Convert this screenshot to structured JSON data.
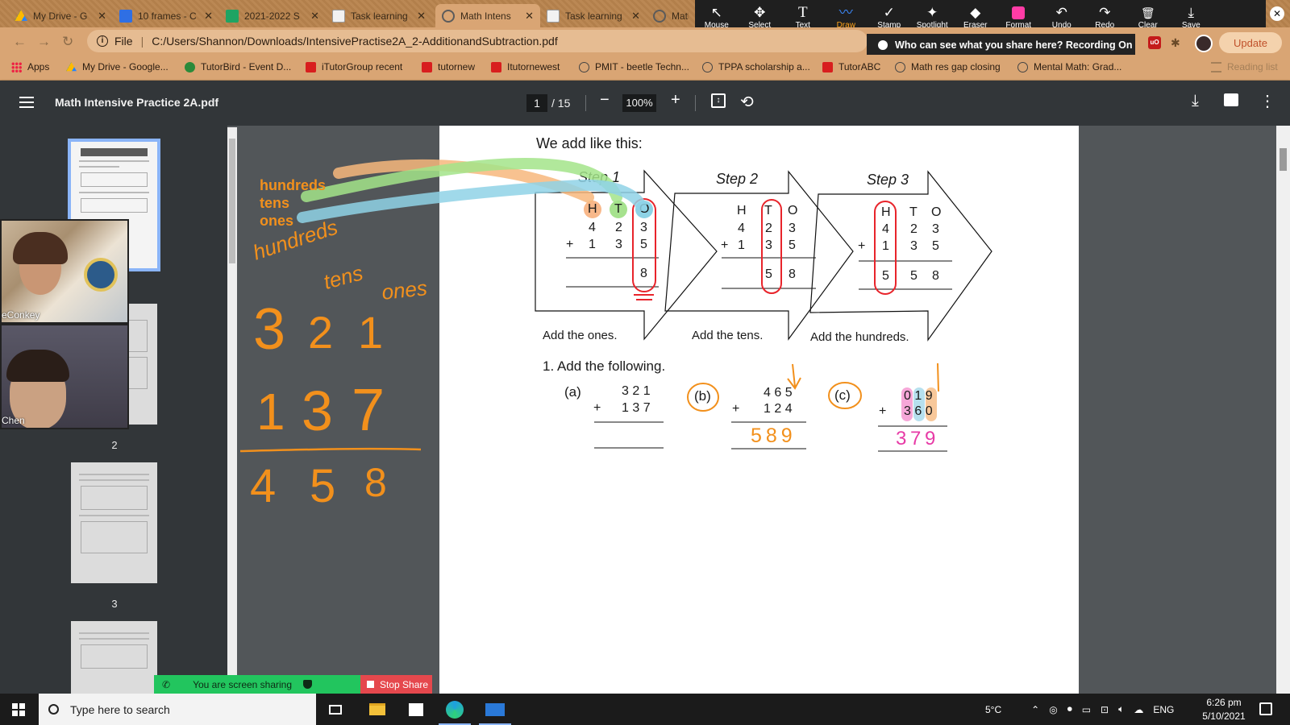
{
  "tabs": [
    {
      "label": "My Drive - G",
      "icon": "google-drive-icon",
      "close": "✕"
    },
    {
      "label": "10 frames - C",
      "icon": "google-docs-icon",
      "close": "✕"
    },
    {
      "label": "2021-2022 S",
      "icon": "google-sheets-icon",
      "close": "✕"
    },
    {
      "label": "Task learning",
      "icon": "page-icon",
      "close": "✕"
    },
    {
      "label": "Math Intens",
      "icon": "globe-icon",
      "close": "✕"
    },
    {
      "label": "Task learning",
      "icon": "page-icon",
      "close": "✕"
    },
    {
      "label": "MathT",
      "icon": "globe-icon"
    }
  ],
  "annotation_toolbar": {
    "tools": [
      {
        "label": "Mouse",
        "icon": "↖"
      },
      {
        "label": "Select",
        "icon": "✥"
      },
      {
        "label": "Text",
        "icon": "T"
      },
      {
        "label": "Draw",
        "icon": "〰"
      },
      {
        "label": "Stamp",
        "icon": "✓"
      },
      {
        "label": "Spotlight",
        "icon": "✦"
      },
      {
        "label": "Eraser",
        "icon": "◆"
      },
      {
        "label": "Format",
        "icon": ""
      },
      {
        "label": "Undo",
        "icon": "↶"
      },
      {
        "label": "Redo",
        "icon": "↷"
      },
      {
        "label": "Clear",
        "icon": "🗑"
      },
      {
        "label": "Save",
        "icon": "⤓"
      }
    ],
    "selected": "Draw",
    "format_color": "#ff3ca6",
    "close_glyph": "✕"
  },
  "address": {
    "scheme": "File",
    "url": "C:/Users/Shannon/Downloads/IntensivePractise2A_2-AdditionandSubtraction.pdf"
  },
  "share_notice": "Who can see what you share here? Recording On",
  "update_button": "Update",
  "extension_badge": "uO",
  "bookmarks": [
    {
      "label": "Apps",
      "icon": "apps-grid-icon"
    },
    {
      "label": "My Drive - Google...",
      "icon": "google-drive-icon"
    },
    {
      "label": "TutorBird - Event D...",
      "icon": "tutorbird-icon"
    },
    {
      "label": "iTutorGroup recent",
      "icon": "itutor-icon"
    },
    {
      "label": "tutornew",
      "icon": "itutor-icon"
    },
    {
      "label": "Itutornewest",
      "icon": "itutor-icon"
    },
    {
      "label": "PMIT - beetle Techn...",
      "icon": "globe-icon"
    },
    {
      "label": "TPPA scholarship a...",
      "icon": "globe-icon"
    },
    {
      "label": "TutorABC",
      "icon": "itutor-icon"
    },
    {
      "label": "Math res gap closing",
      "icon": "globe-icon"
    },
    {
      "label": "Mental Math: Grad...",
      "icon": "globe-icon"
    },
    {
      "label": "Reading list",
      "icon": "reading-list-icon"
    }
  ],
  "pdf": {
    "title": "Math Intensive Practice 2A.pdf",
    "page": "1",
    "page_total": "/ 15",
    "zoom": "100%",
    "thumb_numbers": [
      "2",
      "3"
    ]
  },
  "document": {
    "intro": "We add like this:",
    "steps": [
      {
        "title": "Step 1",
        "caption": "Add the ones."
      },
      {
        "title": "Step 2",
        "caption": "Add the tens."
      },
      {
        "title": "Step 3",
        "caption": "Add the hundreds."
      }
    ],
    "headers": [
      "H",
      "T",
      "O"
    ],
    "plus": "+",
    "addend1": [
      "4",
      "2",
      "3"
    ],
    "addend2": [
      "1",
      "3",
      "5"
    ],
    "step_results": [
      [
        "",
        "",
        "8"
      ],
      [
        "",
        "5",
        "8"
      ],
      [
        "5",
        "5",
        "8"
      ]
    ],
    "question": "1.  Add the following.",
    "problems": [
      {
        "label": "(a)",
        "top": "3 2 1",
        "bottom": "1 3 7",
        "answer": ""
      },
      {
        "label": "(b)",
        "top": "4 6 5",
        "bottom": "1 2 4",
        "answer": "5 8 9"
      },
      {
        "label": "(c)",
        "top": "0 1 9",
        "bottom": "3 6 0",
        "answer": "3 7 9"
      }
    ]
  },
  "ink": {
    "labels": [
      "hundreds",
      "tens",
      "ones"
    ],
    "handwriting": [
      "hundreds",
      "tens",
      "ones"
    ],
    "sum_top": [
      "3",
      "2",
      "1"
    ],
    "sum_bottom": [
      "1",
      "3",
      "7"
    ],
    "sum_result": [
      "4",
      "5",
      "8"
    ],
    "ink_color": "#f2901c",
    "highlight_colors": {
      "hundreds": "#f8b88a",
      "tens": "#a6e28e",
      "ones": "#8ed3e6"
    }
  },
  "participants": [
    {
      "name": "eConkey"
    },
    {
      "name": "Chen"
    }
  ],
  "screen_share": {
    "status": "You are screen sharing",
    "stop": "Stop Share"
  },
  "taskbar": {
    "search_placeholder": "Type here to search",
    "temperature": "5°C",
    "language": "ENG",
    "time": "6:26 pm",
    "date": "5/10/2021"
  }
}
